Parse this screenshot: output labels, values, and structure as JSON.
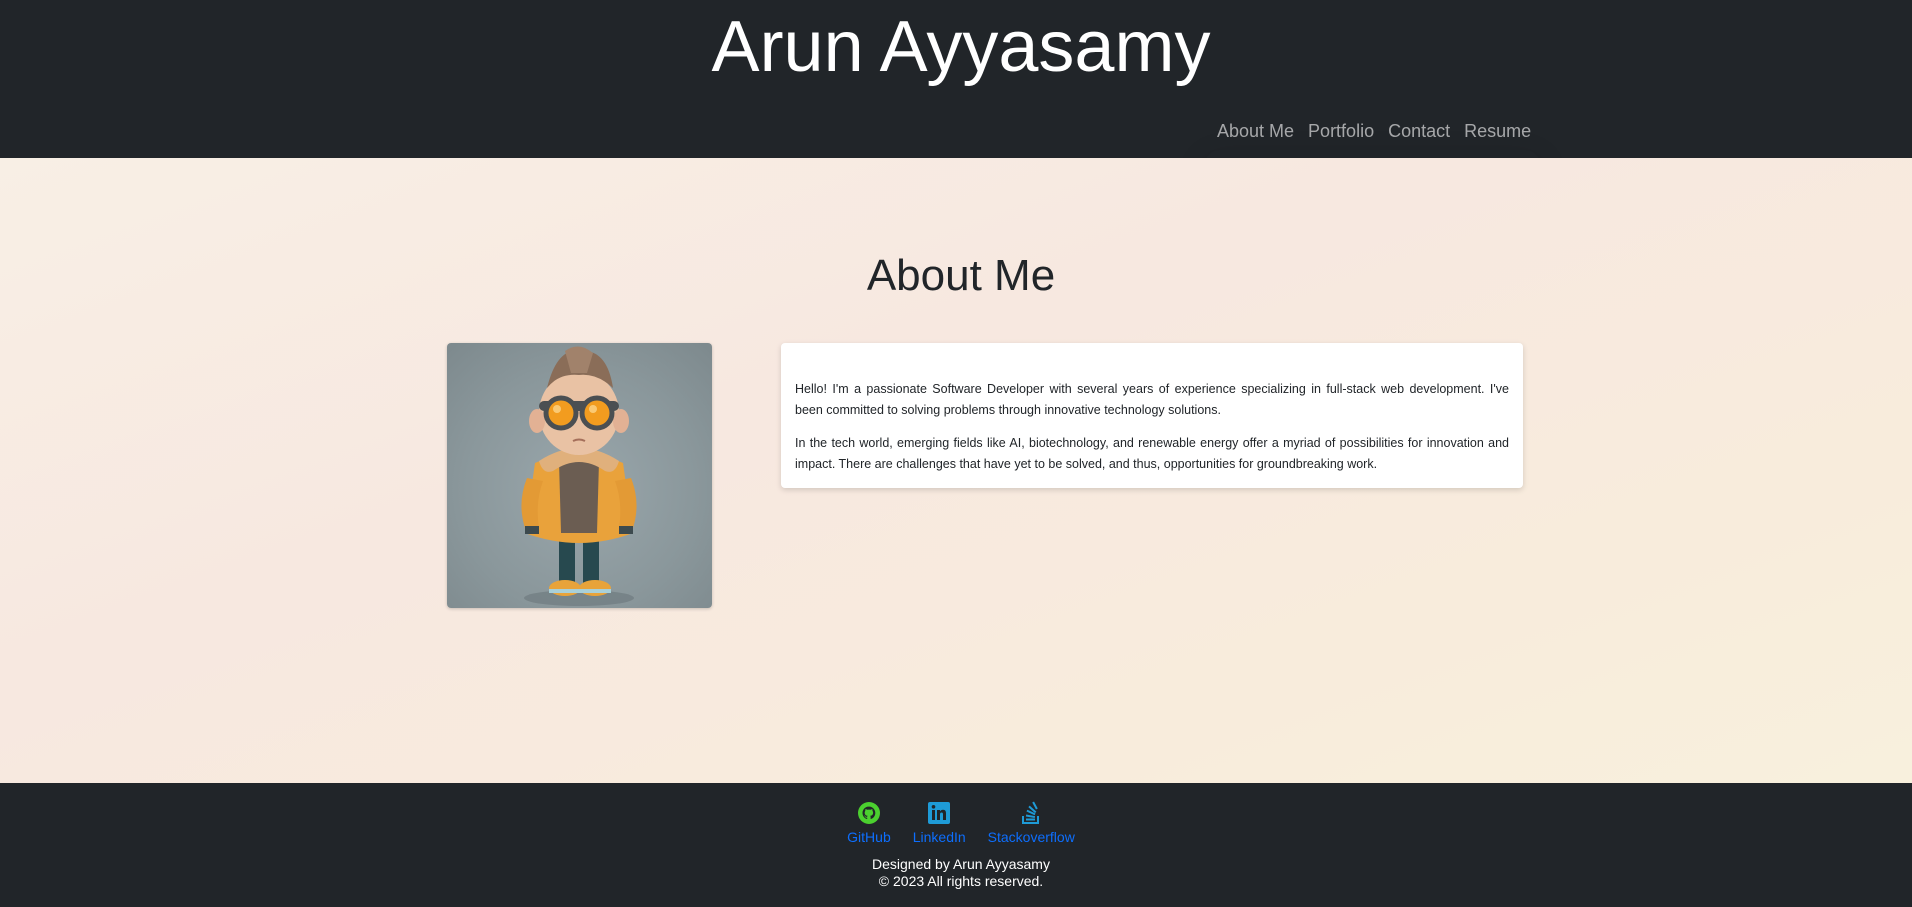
{
  "header": {
    "title": "Arun Ayyasamy",
    "nav": [
      "About Me",
      "Portfolio",
      "Contact",
      "Resume"
    ]
  },
  "about": {
    "heading": "About Me",
    "paragraphs": [
      "Hello! I'm a passionate Software Developer with several years of experience specializing in full-stack web development. I've been committed to solving problems through innovative technology solutions.",
      "In the tech world, emerging fields like AI, biotechnology, and renewable energy offer a myriad of possibilities for innovation and impact. There are challenges that have yet to be solved, and thus, opportunities for groundbreaking work."
    ]
  },
  "footer": {
    "links": [
      {
        "label": "GitHub",
        "icon": "github-icon",
        "color": "#4bd02f"
      },
      {
        "label": "LinkedIn",
        "icon": "linkedin-icon",
        "color": "#1e9bd7"
      },
      {
        "label": "Stackoverflow",
        "icon": "stackoverflow-icon",
        "color": "#1e9bd7"
      }
    ],
    "designed_by": "Designed by Arun Ayyasamy",
    "copyright": "© 2023 All rights reserved."
  },
  "colors": {
    "header_bg": "#212529",
    "link": "#0d6efd"
  }
}
